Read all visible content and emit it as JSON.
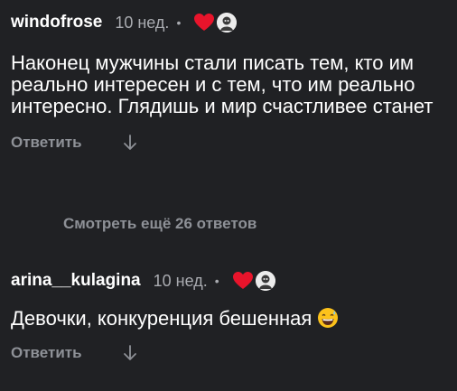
{
  "comments": [
    {
      "username": "windofrose",
      "time": "10 нед.",
      "separator": "•",
      "text": "Наконец мужчины стали писать тем, кто им реально интересен и с тем, что им реально интересно. Глядишь и мир счастливее станет",
      "reply_label": "Ответить"
    },
    {
      "username": "arina__kulagina",
      "time": "10 нед.",
      "separator": "•",
      "text": "Девочки, конкуренция бешенная",
      "reply_label": "Ответить"
    }
  ],
  "more_replies_label": "Смотреть ещё 26 ответов",
  "colors": {
    "background": "#202124",
    "heart": "#e8142b",
    "muted_text": "#8e9197"
  },
  "icons": [
    "heart-icon",
    "author-avatar",
    "down-arrow-icon",
    "grinning-sweat-emoji"
  ]
}
